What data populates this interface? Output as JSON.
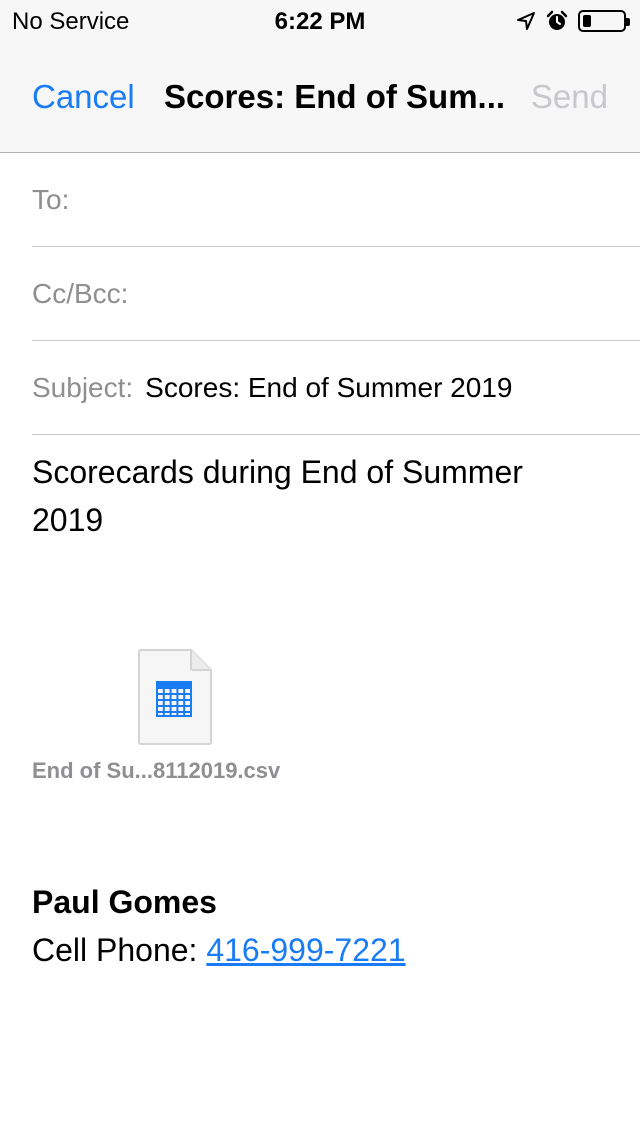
{
  "status_bar": {
    "carrier": "No Service",
    "time": "6:22 PM",
    "icons": [
      "location-arrow-icon",
      "alarm-icon",
      "battery-icon"
    ],
    "battery_level": 0.2
  },
  "nav": {
    "cancel_label": "Cancel",
    "title": "Scores: End of Sum...",
    "send_label": "Send"
  },
  "fields": {
    "to_label": "To:",
    "cc_label": "Cc/Bcc:",
    "subject_label": "Subject:",
    "subject_value": "Scores: End of Summer 2019"
  },
  "body": {
    "text": "Scorecards during End of Summer 2019"
  },
  "attachment": {
    "name": "End of Su...8112019.csv",
    "icon": "spreadsheet-document-icon"
  },
  "signature": {
    "name": "Paul Gomes",
    "phone_label": "Cell Phone: ",
    "phone_number": "416-999-7221"
  },
  "colors": {
    "accent": "#1a7cf4",
    "disabled": "#c7c7cc",
    "label_gray": "#8e8e93"
  }
}
